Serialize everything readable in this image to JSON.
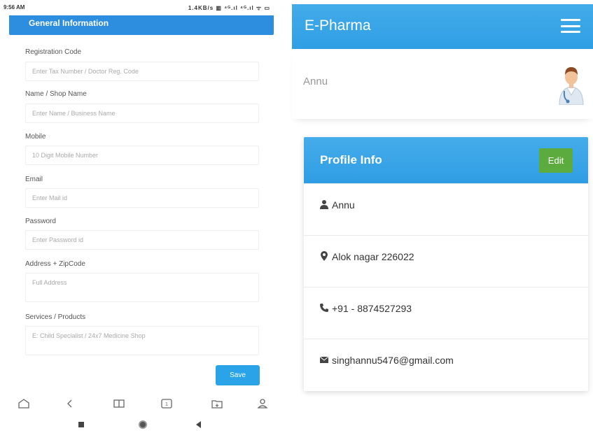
{
  "left_screen": {
    "status_bar": {
      "time": "9:56 AM",
      "indicators": "1.4KB/s ▥ ⁴ᴳ.ıl ⁴ᴳ.ıl ᯤ ▭"
    },
    "section_title": "General Information",
    "fields": [
      {
        "label": "Registration Code",
        "placeholder": "Enter Tax Number / Doctor Reg. Code"
      },
      {
        "label": "Name / Shop Name",
        "placeholder": "Enter Name / Business Name"
      },
      {
        "label": "Mobile",
        "placeholder": "10 Digit Mobile Number"
      },
      {
        "label": "Email",
        "placeholder": "Enter Mail id"
      },
      {
        "label": "Password",
        "placeholder": "Enter Password id"
      },
      {
        "label": "Address + ZipCode",
        "placeholder": "Full Address"
      },
      {
        "label": "Services / Products",
        "placeholder": "E: Child Specialist / 24x7 Medicine Shop"
      }
    ],
    "save_label": "Save",
    "browser_icons": [
      "home-icon",
      "back-icon",
      "book-icon",
      "tab-icon",
      "folder-icon",
      "profile-icon"
    ],
    "android_nav_icons": [
      "recents-icon",
      "home-circle-icon",
      "back-triangle-icon"
    ]
  },
  "right_screen": {
    "app_title": "E-Pharma",
    "user_name": "Annu",
    "card_title": "Profile Info",
    "edit_label": "Edit",
    "info": {
      "name": "Annu",
      "address": "Alok nagar 226022",
      "phone": "+91 - 8874527293",
      "email": "singhannu5476@gmail.com"
    },
    "icons": {
      "name": "user-icon",
      "address": "map-marker-icon",
      "phone": "phone-icon",
      "email": "envelope-icon"
    }
  },
  "colors": {
    "primary_blue": "#2e9fe4",
    "header_blue": "#2d8ee0",
    "edit_green": "#5cab3f",
    "save_blue": "#2aa3e8"
  }
}
